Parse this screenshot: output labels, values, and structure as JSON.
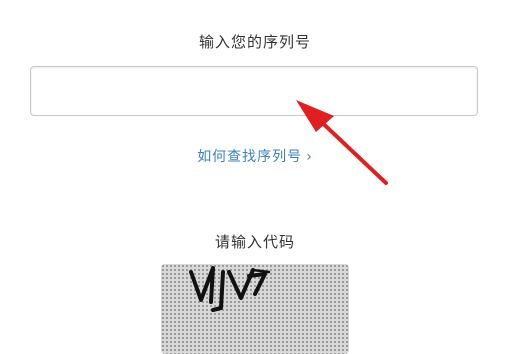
{
  "serial_section": {
    "label": "输入您的序列号",
    "input_value": "",
    "input_placeholder": ""
  },
  "help_link": {
    "label": "如何查找序列号",
    "chevron": "›"
  },
  "code_section": {
    "label": "请输入代码",
    "captcha_text": "NJV7"
  },
  "colors": {
    "link": "#3a82c4",
    "annotation_arrow": "#e02020",
    "text": "#333333"
  },
  "icons": {
    "chevron": "chevron-right-icon",
    "annotation": "red-arrow-annotation"
  }
}
